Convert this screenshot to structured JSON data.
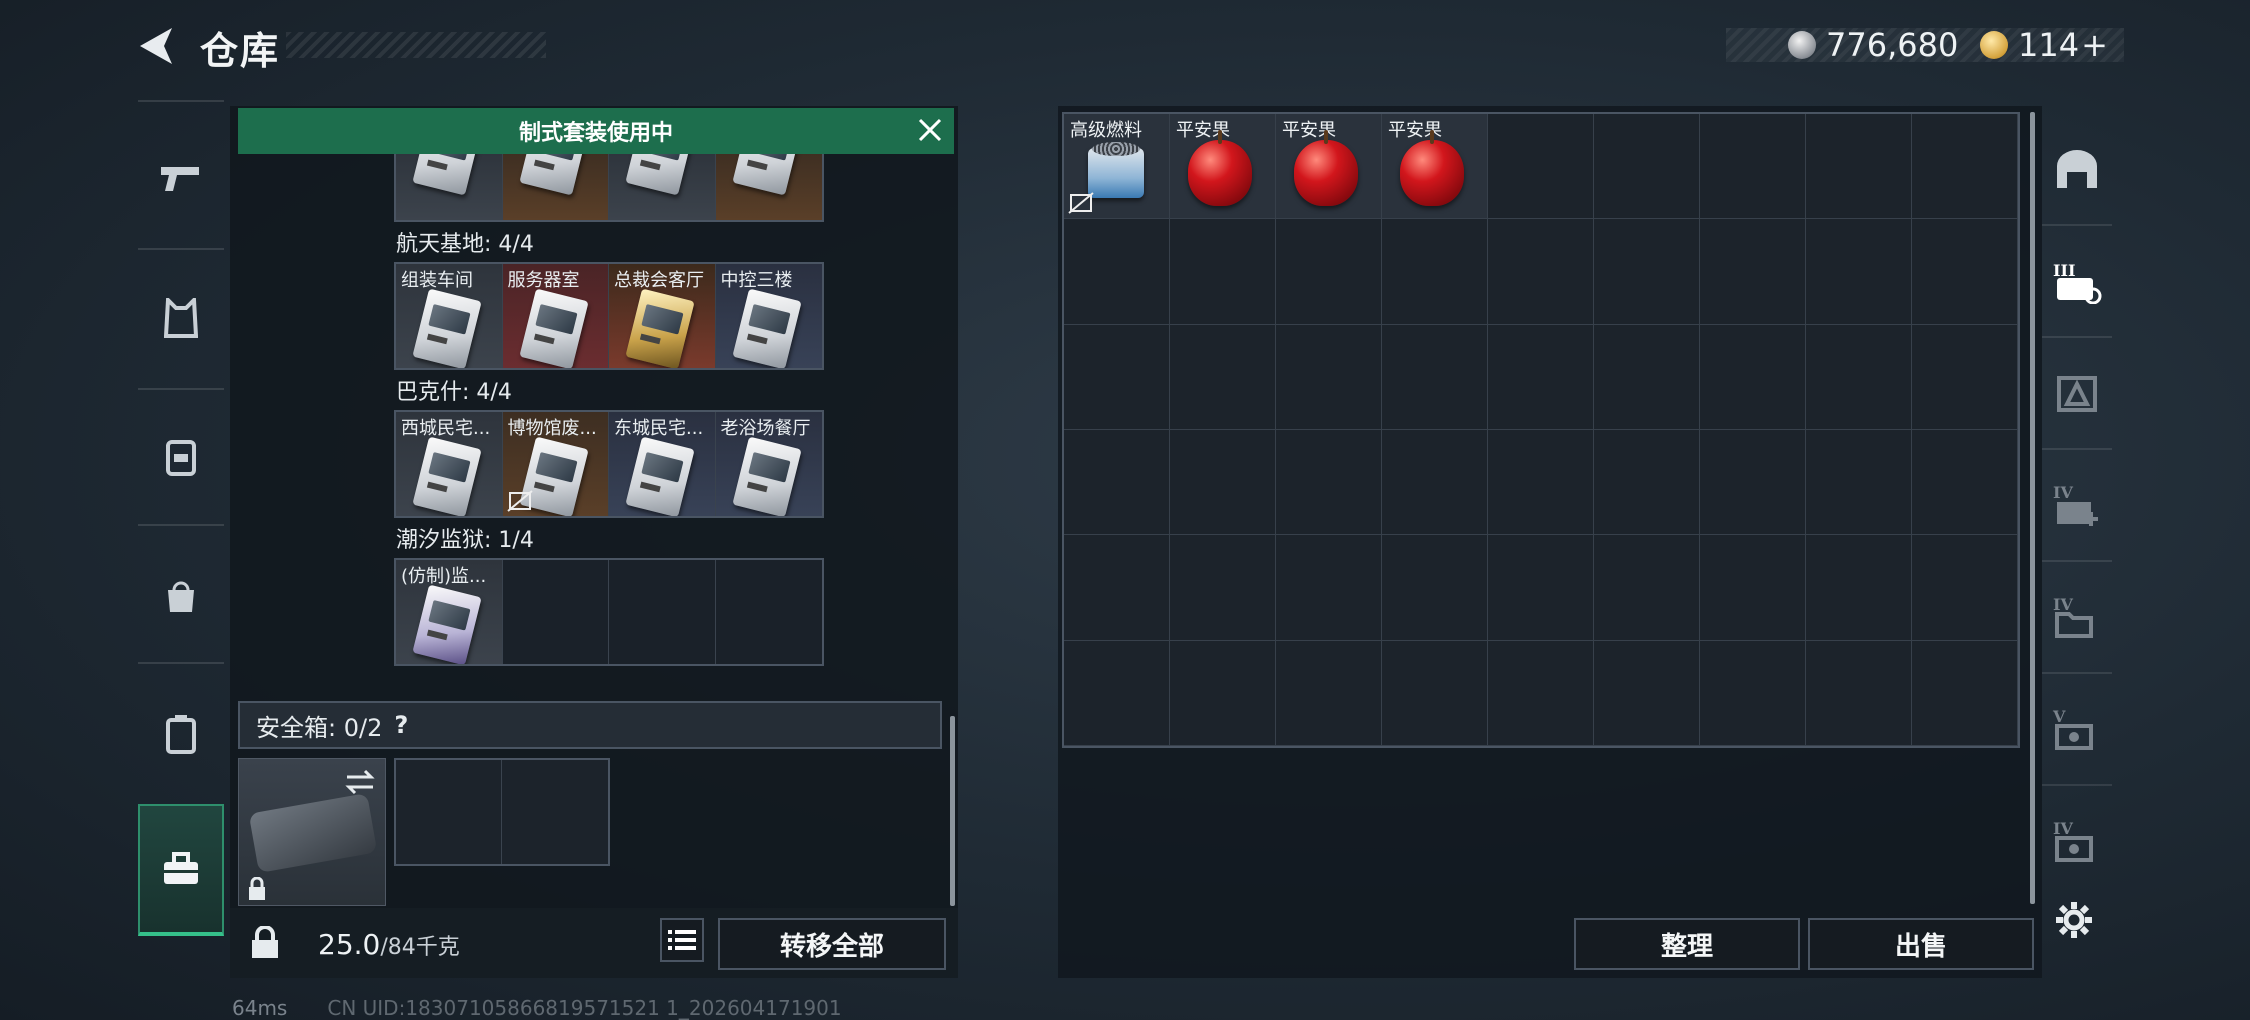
{
  "header": {
    "title": "仓库"
  },
  "currency": {
    "silver": "776,680",
    "gold": "114",
    "gold_plus": "+"
  },
  "banner": {
    "text": "制式套装使用中"
  },
  "groups": [
    {
      "title": "航天基地: 4/4",
      "items": [
        {
          "label": "组装车间",
          "bg": "grey"
        },
        {
          "label": "服务器室",
          "bg": "red"
        },
        {
          "label": "总裁会客厅",
          "bg": "gold"
        },
        {
          "label": "中控三楼",
          "bg": "blue"
        }
      ]
    },
    {
      "title": "巴克什: 4/4",
      "items": [
        {
          "label": "西城民宅...",
          "bg": "grey"
        },
        {
          "label": "博物馆废...",
          "bg": "brown"
        },
        {
          "label": "东城民宅...",
          "bg": "blue"
        },
        {
          "label": "老浴场餐厅",
          "bg": "blue"
        }
      ]
    },
    {
      "title": "潮汐监狱: 1/4",
      "items": [
        {
          "label": "(仿制)监...",
          "bg": "grey"
        }
      ]
    }
  ],
  "safebox": {
    "label": "安全箱: 0/2",
    "help": "?"
  },
  "weight": {
    "current": "25.0",
    "max": "/84千克"
  },
  "buttons": {
    "transfer_all": "转移全部",
    "organize": "整理",
    "sell": "出售"
  },
  "stash": {
    "items": [
      {
        "label": "高级燃料",
        "type": "fuel"
      },
      {
        "label": "平安果",
        "type": "apple"
      },
      {
        "label": "平安果",
        "type": "apple"
      },
      {
        "label": "平安果",
        "type": "apple"
      }
    ]
  },
  "status": {
    "ping": "64ms",
    "uid": "CN UID:18307105866819571521 1_202604171901"
  }
}
